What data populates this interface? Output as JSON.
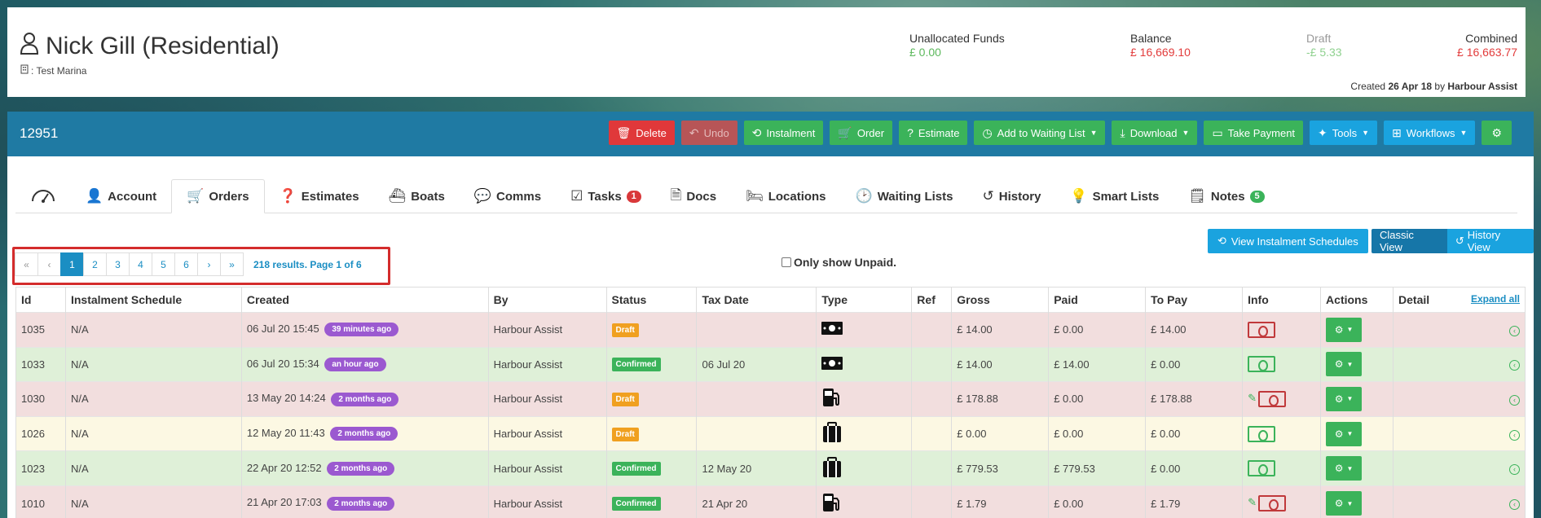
{
  "customer": {
    "name": "Nick Gill (Residential)",
    "marina": ": Test Marina",
    "created_prefix": "Created",
    "created_date": "26 Apr 18",
    "created_by_prefix": "by",
    "created_by": "Harbour Assist"
  },
  "financials": {
    "unallocated_label": "Unallocated Funds",
    "unallocated_value": "£ 0.00",
    "balance_label": "Balance",
    "balance_value": "£ 16,669.10",
    "draft_label": "Draft",
    "draft_value": "-£ 5.33",
    "combined_label": "Combined",
    "combined_value": "£ 16,663.77"
  },
  "account_bar": {
    "account_id": "12951",
    "buttons": {
      "delete": "Delete",
      "undo": "Undo",
      "instalment": "Instalment",
      "order": "Order",
      "estimate": "Estimate",
      "waiting_list": "Add to Waiting List",
      "download": "Download",
      "take_payment": "Take Payment",
      "tools": "Tools",
      "workflows": "Workflows"
    }
  },
  "tabs": {
    "account": "Account",
    "orders": "Orders",
    "estimates": "Estimates",
    "boats": "Boats",
    "comms": "Comms",
    "tasks": "Tasks",
    "tasks_count": "1",
    "docs": "Docs",
    "locations": "Locations",
    "waiting_lists": "Waiting Lists",
    "history": "History",
    "smart_lists": "Smart Lists",
    "notes": "Notes",
    "notes_count": "5"
  },
  "pagination": {
    "first": "«",
    "prev": "‹",
    "pages": [
      "1",
      "2",
      "3",
      "4",
      "5",
      "6"
    ],
    "next": "›",
    "last": "»",
    "results": "218 results. Page 1 of 6"
  },
  "filters": {
    "only_unpaid": "Only show Unpaid."
  },
  "view_buttons": {
    "instalment_schedules": "View Instalment Schedules",
    "classic": "Classic View",
    "history": "History View"
  },
  "table": {
    "headers": [
      "Id",
      "Instalment Schedule",
      "Created",
      "By",
      "Status",
      "Tax Date",
      "Type",
      "Ref",
      "Gross",
      "Paid",
      "To Pay",
      "Info",
      "Actions",
      "Detail"
    ],
    "expand_all": "Expand all",
    "rows": [
      {
        "id": "1035",
        "schedule": "N/A",
        "created": "06 Jul 20 15:45",
        "ago": "39 minutes ago",
        "by": "Harbour Assist",
        "status": "Draft",
        "tax_date": "",
        "type": "cash-icon",
        "ref": "",
        "gross": "£ 14.00",
        "paid": "£ 0.00",
        "to_pay": "£ 14.00",
        "info": "red",
        "edit": false,
        "row": "red"
      },
      {
        "id": "1033",
        "schedule": "N/A",
        "created": "06 Jul 20 15:34",
        "ago": "an hour ago",
        "by": "Harbour Assist",
        "status": "Confirmed",
        "tax_date": "06 Jul 20",
        "type": "cash-icon",
        "ref": "",
        "gross": "£ 14.00",
        "paid": "£ 14.00",
        "to_pay": "£ 0.00",
        "info": "green",
        "edit": false,
        "row": "green"
      },
      {
        "id": "1030",
        "schedule": "N/A",
        "created": "13 May 20 14:24",
        "ago": "2 months ago",
        "by": "Harbour Assist",
        "status": "Draft",
        "tax_date": "",
        "type": "fuel-icon",
        "ref": "",
        "gross": "£ 178.88",
        "paid": "£ 0.00",
        "to_pay": "£ 178.88",
        "info": "red",
        "edit": true,
        "row": "red"
      },
      {
        "id": "1026",
        "schedule": "N/A",
        "created": "12 May 20 11:43",
        "ago": "2 months ago",
        "by": "Harbour Assist",
        "status": "Draft",
        "tax_date": "",
        "type": "luggage-icon",
        "ref": "",
        "gross": "£ 0.00",
        "paid": "£ 0.00",
        "to_pay": "£ 0.00",
        "info": "green",
        "edit": false,
        "row": "yellow"
      },
      {
        "id": "1023",
        "schedule": "N/A",
        "created": "22 Apr 20 12:52",
        "ago": "2 months ago",
        "by": "Harbour Assist",
        "status": "Confirmed",
        "tax_date": "12 May 20",
        "type": "luggage-icon",
        "ref": "",
        "gross": "£ 779.53",
        "paid": "£ 779.53",
        "to_pay": "£ 0.00",
        "info": "green",
        "edit": false,
        "row": "green"
      },
      {
        "id": "1010",
        "schedule": "N/A",
        "created": "21 Apr 20 17:03",
        "ago": "2 months ago",
        "by": "Harbour Assist",
        "status": "Confirmed",
        "tax_date": "21 Apr 20",
        "type": "fuel-icon",
        "ref": "",
        "gross": "£ 1.79",
        "paid": "£ 0.00",
        "to_pay": "£ 1.79",
        "info": "red",
        "edit": true,
        "row": "red"
      }
    ]
  }
}
